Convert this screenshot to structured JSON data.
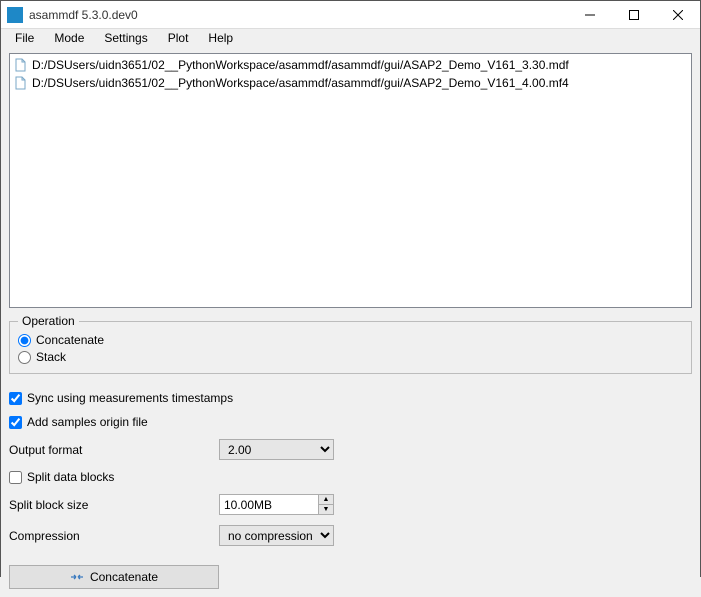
{
  "window": {
    "title": "asammdf 5.3.0.dev0"
  },
  "menu": {
    "items": [
      "File",
      "Mode",
      "Settings",
      "Plot",
      "Help"
    ]
  },
  "files": [
    "D:/DSUsers/uidn3651/02__PythonWorkspace/asammdf/asammdf/gui/ASAP2_Demo_V161_3.30.mdf",
    "D:/DSUsers/uidn3651/02__PythonWorkspace/asammdf/asammdf/gui/ASAP2_Demo_V161_4.00.mf4"
  ],
  "operation": {
    "legend": "Operation",
    "concatenate_label": "Concatenate",
    "stack_label": "Stack",
    "selected": "concatenate"
  },
  "options": {
    "sync_label": "Sync using measurements timestamps",
    "sync_checked": true,
    "origin_label": "Add samples origin file",
    "origin_checked": true,
    "output_format_label": "Output format",
    "output_format_value": "2.00",
    "split_blocks_label": "Split data blocks",
    "split_blocks_checked": false,
    "split_size_label": "Split block size",
    "split_size_value": "10.00MB",
    "compression_label": "Compression",
    "compression_value": "no compression"
  },
  "action": {
    "button_label": "Concatenate"
  }
}
